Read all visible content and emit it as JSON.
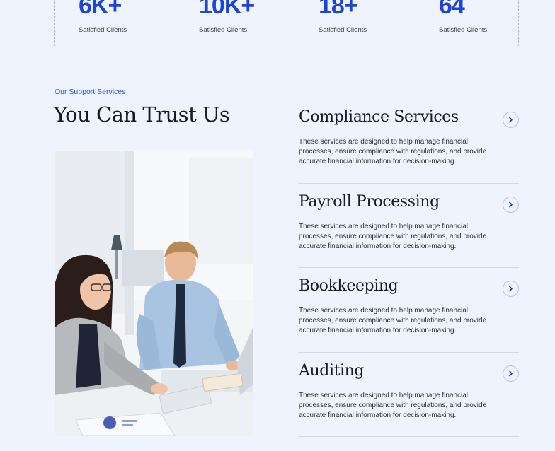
{
  "stats": [
    {
      "value": "6K+",
      "label": "Satisfied Clients"
    },
    {
      "value": "10K+",
      "label": "Satisfied Clients"
    },
    {
      "value": "18+",
      "label": "Satisfied Clients"
    },
    {
      "value": "64",
      "label": "Satisfied Clients"
    }
  ],
  "support": {
    "eyebrow": "Our Support Services",
    "title": "You Can Trust Us"
  },
  "services": [
    {
      "title": "Compliance Services",
      "description": "These services are designed to help manage financial processes, ensure compliance with regulations, and provide accurate financial information for decision-making.",
      "icon": "chevron-right-icon"
    },
    {
      "title": "Payroll Processing",
      "description": "These services are designed to help manage financial processes, ensure compliance with regulations, and provide accurate financial information for decision-making.",
      "icon": "chevron-right-icon"
    },
    {
      "title": "Bookkeeping",
      "description": "These services are designed to help manage financial processes, ensure compliance with regulations, and provide accurate financial information for decision-making.",
      "icon": "chevron-right-icon"
    },
    {
      "title": "Auditing",
      "description": "These services are designed to help manage financial processes, ensure compliance with regulations, and provide accurate financial information for decision-making.",
      "icon": "chevron-right-icon"
    }
  ],
  "colors": {
    "background": "#eef3fd",
    "accent": "#1d44d8",
    "heading": "#161a28"
  }
}
